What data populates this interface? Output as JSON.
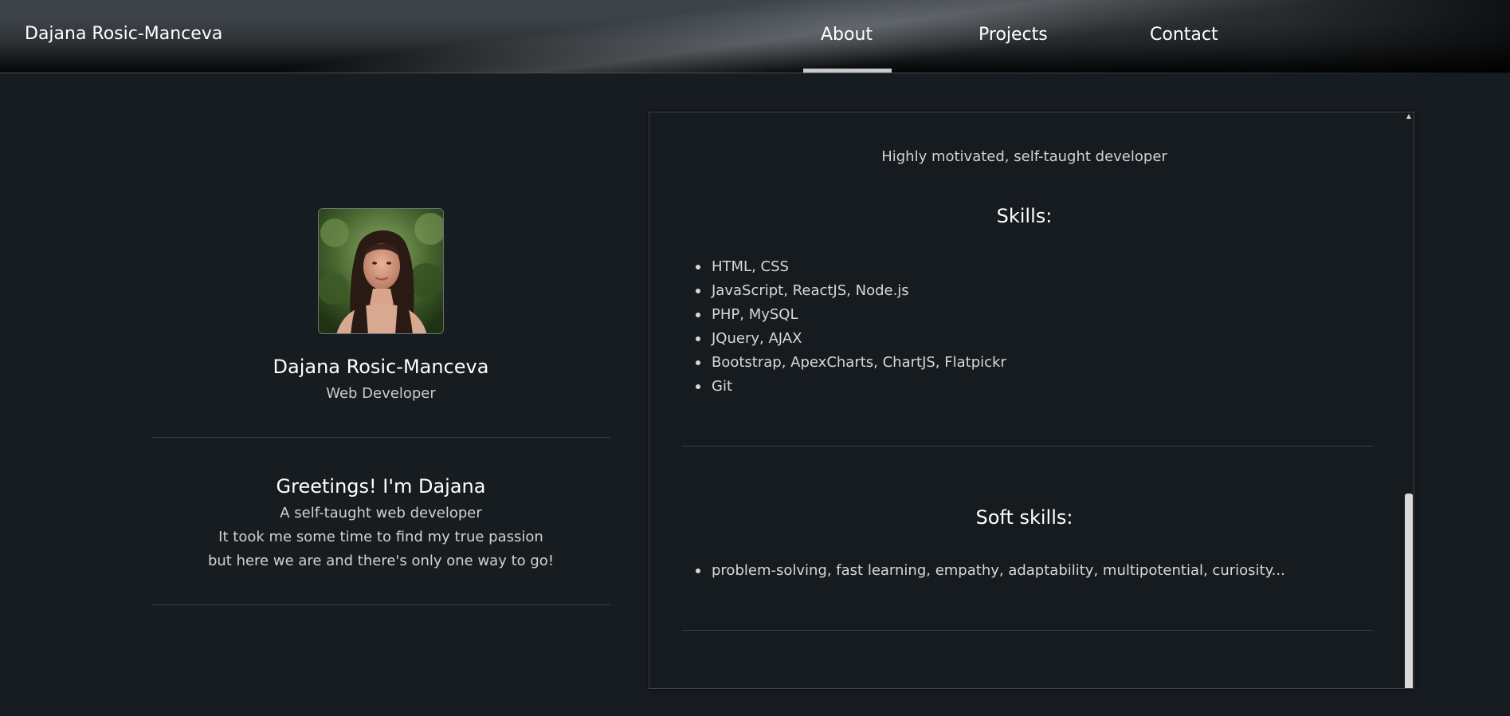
{
  "navbar": {
    "brand": "Dajana Rosic-Manceva",
    "links": [
      {
        "label": "About",
        "active": true
      },
      {
        "label": "Projects",
        "active": false
      },
      {
        "label": "Contact",
        "active": false
      }
    ]
  },
  "profile": {
    "name": "Dajana Rosic-Manceva",
    "role": "Web Developer",
    "greeting_title": "Greetings! I'm Dajana",
    "greeting_lines": [
      "A self-taught web developer",
      "It took me some time to find my true passion",
      "but here we are and there's only one way to go!"
    ]
  },
  "about_panel": {
    "tagline": "Highly motivated, self-taught developer",
    "skills_title": "Skills:",
    "skills": [
      "HTML, CSS",
      "JavaScript, ReactJS, Node.js",
      "PHP, MySQL",
      "JQuery, AJAX",
      "Bootstrap, ApexCharts, ChartJS, Flatpickr",
      "Git"
    ],
    "soft_skills_title": "Soft skills:",
    "soft_skills": [
      "problem-solving, fast learning, empathy, adaptability, multipotential, curiosity..."
    ]
  },
  "colors": {
    "background": "#171c21",
    "text": "#ffffff",
    "muted_text": "#d0d2d4",
    "active_underline": "#c9c9c9",
    "divider": "#3a3f44"
  },
  "icons": {
    "scroll_up": "triangle-up-icon",
    "list_bullet": "bullet-icon"
  }
}
